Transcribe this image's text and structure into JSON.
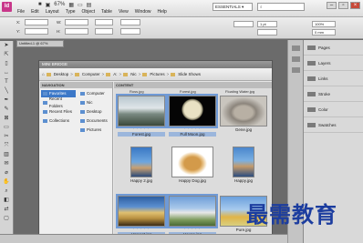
{
  "app": {
    "logo": "Id",
    "zoom": "67%",
    "workspace": "ESSENTIALS ▾",
    "search_placeholder": "",
    "cs_live": "CS Live"
  },
  "menu": [
    "File",
    "Edit",
    "Layout",
    "Type",
    "Object",
    "Table",
    "View",
    "Window",
    "Help"
  ],
  "controlbar": {
    "x_label": "X:",
    "y_label": "Y:",
    "w_label": "W:",
    "h_label": "H:",
    "stroke_value": "1 pt",
    "zoom_value": "100%",
    "opacity_value": "0 mm"
  },
  "doc_tab": "Untitled-1 @ 67%",
  "right_panel": {
    "items": [
      "Pages",
      "Layers",
      "Links",
      "Stroke",
      "Color",
      "Swatches"
    ]
  },
  "mini_bridge": {
    "title": "MINI BRIDGE",
    "path": [
      "Desktop",
      "Computer",
      "A:",
      "Nic",
      "Pictures",
      "Slide Shows"
    ],
    "navigation_header": "NAVIGATION",
    "nav_left": [
      {
        "label": "Favorites",
        "selected": true
      },
      {
        "label": "Recent Folders",
        "selected": false
      },
      {
        "label": "Recent Files",
        "selected": false
      },
      {
        "label": "Collections",
        "selected": false
      }
    ],
    "nav_right": [
      "Computer",
      "Nic",
      "Desktop",
      "Documents",
      "Pictures"
    ],
    "content_header": "CONTENT",
    "top_labels": [
      "Ross.jpg",
      "Forest.jpg",
      "Floating Water.jpg"
    ],
    "thumbnails": [
      {
        "caption": "Forest.jpg",
        "selected": true,
        "stars": "· · · · ·"
      },
      {
        "caption": "Full Moon.jpg",
        "selected": true,
        "stars": "· · · · ·"
      },
      {
        "caption": "Gene.jpg",
        "selected": false,
        "stars": ""
      },
      {
        "caption": "Happy 2.jpg",
        "selected": false,
        "stars": ""
      },
      {
        "caption": "Happy Dog.jpg",
        "selected": false,
        "stars": ""
      },
      {
        "caption": "Happy.jpg",
        "selected": false,
        "stars": ""
      },
      {
        "caption": "Harvest.jpg",
        "selected": true,
        "stars": "· · · · ·"
      },
      {
        "caption": "House.jpg",
        "selected": true,
        "stars": "· · · · ·"
      },
      {
        "caption": "Pure.jpg",
        "selected": false,
        "stars": ""
      }
    ]
  },
  "watermark": "最需教育"
}
